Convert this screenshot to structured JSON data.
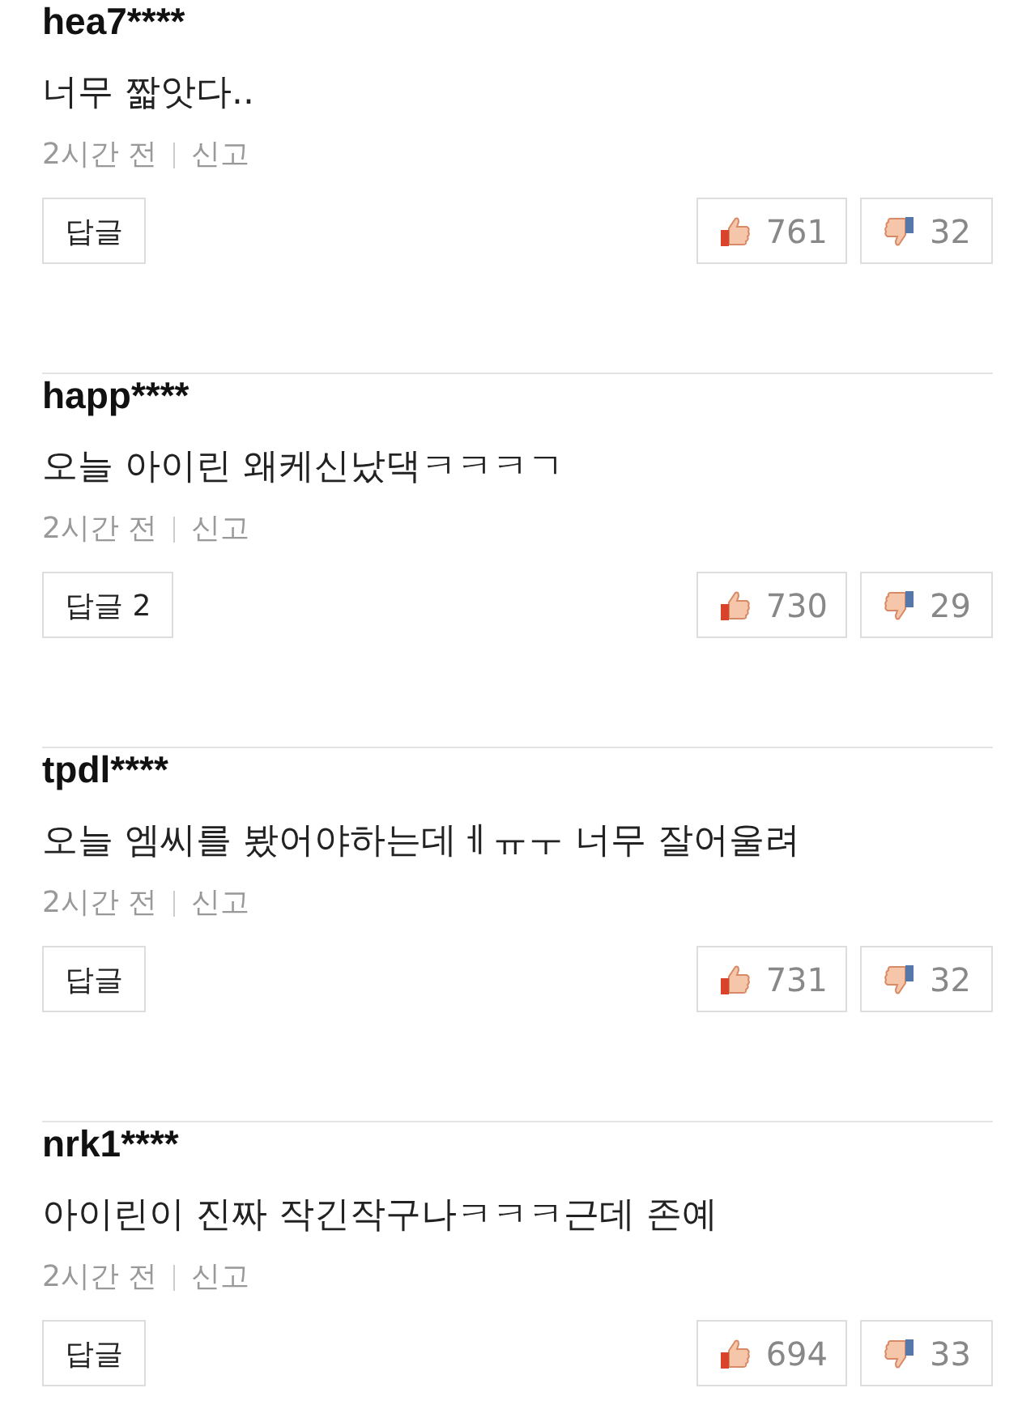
{
  "comments": [
    {
      "user": "hea7****",
      "text": "너무 짧앗다..",
      "time": "2시간 전",
      "report": "신고",
      "reply": "답글",
      "likes": "761",
      "dislikes": "32"
    },
    {
      "user": "happ****",
      "text": "오늘 아이린 왜케신났댁ㅋㅋㅋㄱ",
      "time": "2시간 전",
      "report": "신고",
      "reply": "답글 2",
      "likes": "730",
      "dislikes": "29"
    },
    {
      "user": "tpdl****",
      "text": "오늘 엠씨를 봤어야하는데ㅔㅠㅜ 너무 잘어울려",
      "time": "2시간 전",
      "report": "신고",
      "reply": "답글",
      "likes": "731",
      "dislikes": "32"
    },
    {
      "user": "nrk1****",
      "text": "아이린이 진짜 작긴작구나ㅋㅋㅋ근데 존예",
      "time": "2시간 전",
      "report": "신고",
      "reply": "답글",
      "likes": "694",
      "dislikes": "33"
    }
  ]
}
